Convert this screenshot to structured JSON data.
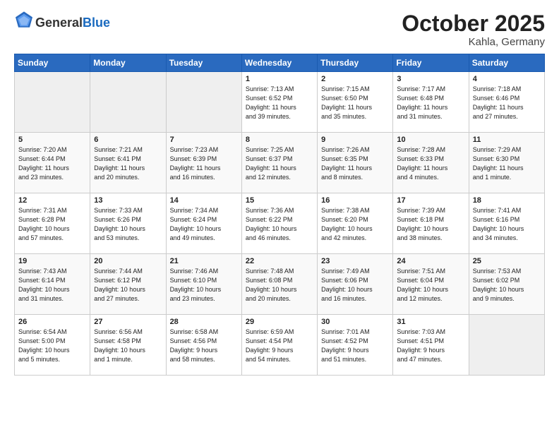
{
  "header": {
    "logo_general": "General",
    "logo_blue": "Blue",
    "month": "October 2025",
    "location": "Kahla, Germany"
  },
  "days_of_week": [
    "Sunday",
    "Monday",
    "Tuesday",
    "Wednesday",
    "Thursday",
    "Friday",
    "Saturday"
  ],
  "weeks": [
    [
      {
        "day": "",
        "info": ""
      },
      {
        "day": "",
        "info": ""
      },
      {
        "day": "",
        "info": ""
      },
      {
        "day": "1",
        "info": "Sunrise: 7:13 AM\nSunset: 6:52 PM\nDaylight: 11 hours\nand 39 minutes."
      },
      {
        "day": "2",
        "info": "Sunrise: 7:15 AM\nSunset: 6:50 PM\nDaylight: 11 hours\nand 35 minutes."
      },
      {
        "day": "3",
        "info": "Sunrise: 7:17 AM\nSunset: 6:48 PM\nDaylight: 11 hours\nand 31 minutes."
      },
      {
        "day": "4",
        "info": "Sunrise: 7:18 AM\nSunset: 6:46 PM\nDaylight: 11 hours\nand 27 minutes."
      }
    ],
    [
      {
        "day": "5",
        "info": "Sunrise: 7:20 AM\nSunset: 6:44 PM\nDaylight: 11 hours\nand 23 minutes."
      },
      {
        "day": "6",
        "info": "Sunrise: 7:21 AM\nSunset: 6:41 PM\nDaylight: 11 hours\nand 20 minutes."
      },
      {
        "day": "7",
        "info": "Sunrise: 7:23 AM\nSunset: 6:39 PM\nDaylight: 11 hours\nand 16 minutes."
      },
      {
        "day": "8",
        "info": "Sunrise: 7:25 AM\nSunset: 6:37 PM\nDaylight: 11 hours\nand 12 minutes."
      },
      {
        "day": "9",
        "info": "Sunrise: 7:26 AM\nSunset: 6:35 PM\nDaylight: 11 hours\nand 8 minutes."
      },
      {
        "day": "10",
        "info": "Sunrise: 7:28 AM\nSunset: 6:33 PM\nDaylight: 11 hours\nand 4 minutes."
      },
      {
        "day": "11",
        "info": "Sunrise: 7:29 AM\nSunset: 6:30 PM\nDaylight: 11 hours\nand 1 minute."
      }
    ],
    [
      {
        "day": "12",
        "info": "Sunrise: 7:31 AM\nSunset: 6:28 PM\nDaylight: 10 hours\nand 57 minutes."
      },
      {
        "day": "13",
        "info": "Sunrise: 7:33 AM\nSunset: 6:26 PM\nDaylight: 10 hours\nand 53 minutes."
      },
      {
        "day": "14",
        "info": "Sunrise: 7:34 AM\nSunset: 6:24 PM\nDaylight: 10 hours\nand 49 minutes."
      },
      {
        "day": "15",
        "info": "Sunrise: 7:36 AM\nSunset: 6:22 PM\nDaylight: 10 hours\nand 46 minutes."
      },
      {
        "day": "16",
        "info": "Sunrise: 7:38 AM\nSunset: 6:20 PM\nDaylight: 10 hours\nand 42 minutes."
      },
      {
        "day": "17",
        "info": "Sunrise: 7:39 AM\nSunset: 6:18 PM\nDaylight: 10 hours\nand 38 minutes."
      },
      {
        "day": "18",
        "info": "Sunrise: 7:41 AM\nSunset: 6:16 PM\nDaylight: 10 hours\nand 34 minutes."
      }
    ],
    [
      {
        "day": "19",
        "info": "Sunrise: 7:43 AM\nSunset: 6:14 PM\nDaylight: 10 hours\nand 31 minutes."
      },
      {
        "day": "20",
        "info": "Sunrise: 7:44 AM\nSunset: 6:12 PM\nDaylight: 10 hours\nand 27 minutes."
      },
      {
        "day": "21",
        "info": "Sunrise: 7:46 AM\nSunset: 6:10 PM\nDaylight: 10 hours\nand 23 minutes."
      },
      {
        "day": "22",
        "info": "Sunrise: 7:48 AM\nSunset: 6:08 PM\nDaylight: 10 hours\nand 20 minutes."
      },
      {
        "day": "23",
        "info": "Sunrise: 7:49 AM\nSunset: 6:06 PM\nDaylight: 10 hours\nand 16 minutes."
      },
      {
        "day": "24",
        "info": "Sunrise: 7:51 AM\nSunset: 6:04 PM\nDaylight: 10 hours\nand 12 minutes."
      },
      {
        "day": "25",
        "info": "Sunrise: 7:53 AM\nSunset: 6:02 PM\nDaylight: 10 hours\nand 9 minutes."
      }
    ],
    [
      {
        "day": "26",
        "info": "Sunrise: 6:54 AM\nSunset: 5:00 PM\nDaylight: 10 hours\nand 5 minutes."
      },
      {
        "day": "27",
        "info": "Sunrise: 6:56 AM\nSunset: 4:58 PM\nDaylight: 10 hours\nand 1 minute."
      },
      {
        "day": "28",
        "info": "Sunrise: 6:58 AM\nSunset: 4:56 PM\nDaylight: 9 hours\nand 58 minutes."
      },
      {
        "day": "29",
        "info": "Sunrise: 6:59 AM\nSunset: 4:54 PM\nDaylight: 9 hours\nand 54 minutes."
      },
      {
        "day": "30",
        "info": "Sunrise: 7:01 AM\nSunset: 4:52 PM\nDaylight: 9 hours\nand 51 minutes."
      },
      {
        "day": "31",
        "info": "Sunrise: 7:03 AM\nSunset: 4:51 PM\nDaylight: 9 hours\nand 47 minutes."
      },
      {
        "day": "",
        "info": ""
      }
    ]
  ]
}
